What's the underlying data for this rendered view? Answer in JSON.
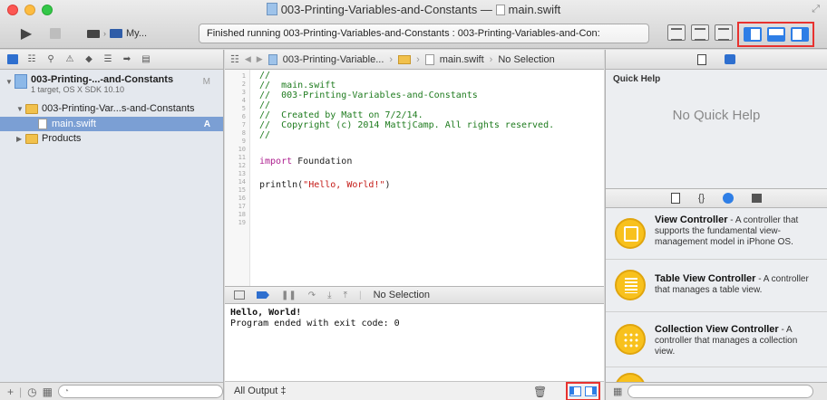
{
  "window": {
    "title": "003-Printing-Variables-and-Constants",
    "title_sep": "—",
    "file": "main.swift"
  },
  "toolbar": {
    "scheme_label": "My...",
    "activity": "Finished running 003-Printing-Variables-and-Constants : 003-Printing-Variables-and-Con:"
  },
  "navigator": {
    "project_name": "003-Printing-...-and-Constants",
    "project_sub": "1 target, OS X SDK 10.10",
    "project_badge": "M",
    "group_name": "003-Printing-Var...s-and-Constants",
    "file_name": "main.swift",
    "file_badge": "A",
    "products": "Products"
  },
  "editor": {
    "jump_project": "003-Printing-Variable...",
    "jump_file": "main.swift",
    "jump_selection": "No Selection",
    "line_numbers": [
      "1",
      "2",
      "3",
      "4",
      "5",
      "6",
      "7",
      "8",
      "9",
      "10",
      "11",
      "12",
      "13",
      "14",
      "15",
      "16",
      "17",
      "18",
      "19"
    ],
    "code": {
      "l1": "//",
      "l2": "//  main.swift",
      "l3": "//  003-Printing-Variables-and-Constants",
      "l4": "//",
      "l5": "//  Created by Matt on 7/2/14.",
      "l6": "//  Copyright (c) 2014 MattjCamp. All rights reserved.",
      "l7": "//",
      "l9_kw": "import",
      "l9_rest": " Foundation",
      "l11_fn": "println(",
      "l11_str": "\"Hello, World!\"",
      "l11_end": ")"
    }
  },
  "debug": {
    "selection": "No Selection",
    "console_line1": "Hello, World!",
    "console_line2": "Program ended with exit code: 0",
    "output_label": "All Output ‡"
  },
  "utilities": {
    "quick_help_title": "Quick Help",
    "quick_help_empty": "No Quick Help",
    "library": [
      {
        "name": "View Controller",
        "desc": " - A controller that supports the fundamental view-management model in iPhone OS."
      },
      {
        "name": "Table View Controller",
        "desc": " - A controller that manages a table view."
      },
      {
        "name": "Collection View Controller",
        "desc": " - A controller that manages a collection view."
      }
    ]
  }
}
